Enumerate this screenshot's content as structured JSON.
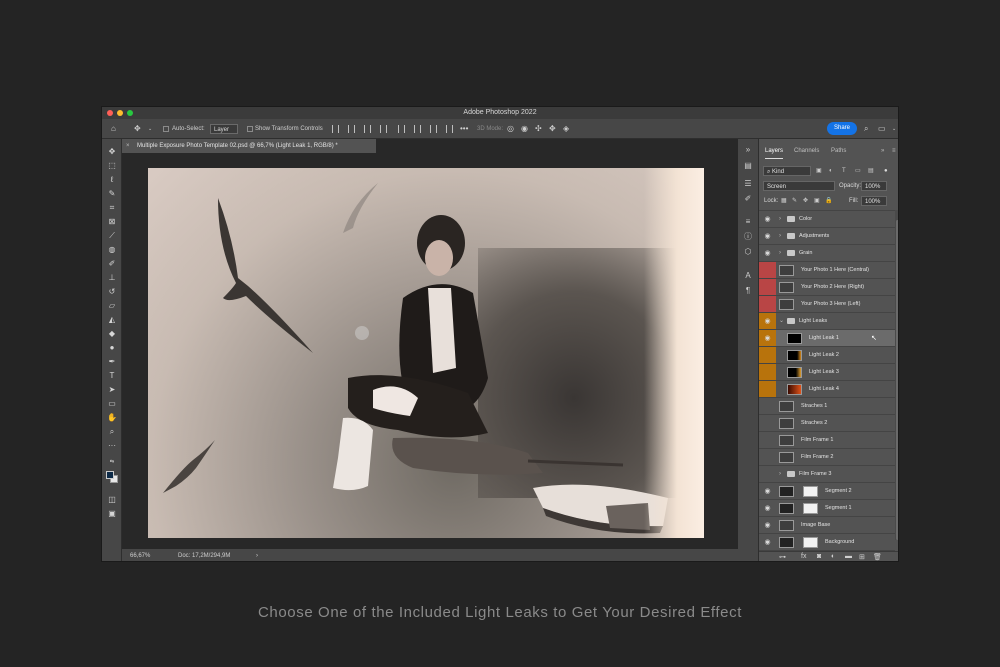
{
  "app": {
    "title": "Adobe Photoshop 2022"
  },
  "options_bar": {
    "auto_select_label": "Auto-Select:",
    "auto_select_value": "Layer",
    "transform_controls_label": "Show Transform Controls",
    "mode_3d_label": "3D Mode:",
    "share_label": "Share"
  },
  "document": {
    "tab_title": "Multiple Exposure Photo Template 02.psd @ 66,7% (Light Leak 1, RGB/8) *",
    "zoom": "66,67%",
    "doc_size": "Doc: 17,2M/294,9M"
  },
  "panel": {
    "tabs": [
      "Layers",
      "Channels",
      "Paths"
    ],
    "kind_label": "Kind",
    "blend_mode": "Screen",
    "opacity_label": "Opacity:",
    "opacity_value": "100%",
    "lock_label": "Lock:",
    "fill_label": "Fill:",
    "fill_value": "100%"
  },
  "layers": [
    {
      "name": "Color",
      "type": "group",
      "visible": true
    },
    {
      "name": "Adjustments",
      "type": "group",
      "visible": true
    },
    {
      "name": "Grain",
      "type": "group",
      "visible": true
    },
    {
      "name": "Your Photo 1 Here (Central)",
      "type": "smart",
      "tag": "red"
    },
    {
      "name": "Your Photo 2 Here (Right)",
      "type": "smart",
      "tag": "red"
    },
    {
      "name": "Your Photo 3 Here (Left)",
      "type": "smart",
      "tag": "red"
    },
    {
      "name": "Light Leaks",
      "type": "group-open",
      "visible": true,
      "tag": "orange"
    },
    {
      "name": "Light Leak 1",
      "type": "layer",
      "visible": true,
      "tag": "orange",
      "selected": true
    },
    {
      "name": "Light Leak 2",
      "type": "layer",
      "tag": "orange"
    },
    {
      "name": "Light Leak 3",
      "type": "layer",
      "tag": "orange"
    },
    {
      "name": "Light Leak 4",
      "type": "layer",
      "tag": "orange"
    },
    {
      "name": "Straches 1",
      "type": "layer"
    },
    {
      "name": "Straches 2",
      "type": "layer"
    },
    {
      "name": "Film Frame 1",
      "type": "smart"
    },
    {
      "name": "Film Frame 2",
      "type": "smart"
    },
    {
      "name": "Film Frame 3",
      "type": "group"
    },
    {
      "name": "Segment 2",
      "type": "masked",
      "visible": true
    },
    {
      "name": "Segment 1",
      "type": "masked",
      "visible": true
    },
    {
      "name": "Image Base",
      "type": "layer",
      "visible": true
    },
    {
      "name": "Background",
      "type": "masked",
      "visible": true
    },
    {
      "name": "Background",
      "type": "layer",
      "visible": true
    }
  ],
  "colors": {
    "tag_red": "#b94545",
    "tag_orange": "#b8730c",
    "selected_row": "#6b6b6b",
    "accent": "#1473e6"
  },
  "caption": "Choose One of the Included Light Leaks to Get Your Desired Effect"
}
